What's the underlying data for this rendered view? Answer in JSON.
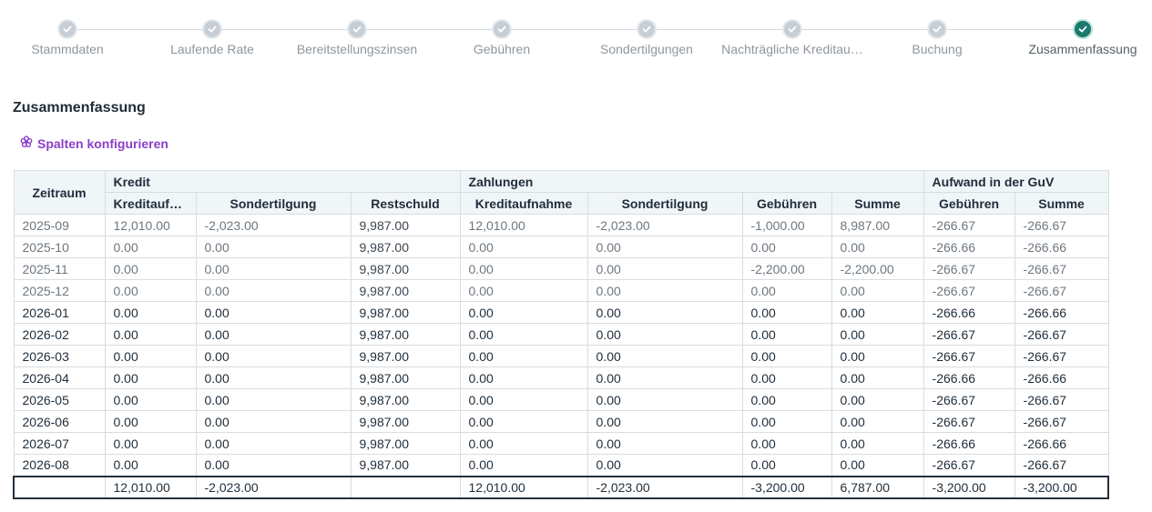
{
  "stepper": {
    "steps": [
      {
        "label": "Stammdaten",
        "state": "done"
      },
      {
        "label": "Laufende Rate",
        "state": "done"
      },
      {
        "label": "Bereitstellungszinsen",
        "state": "done"
      },
      {
        "label": "Gebühren",
        "state": "done"
      },
      {
        "label": "Sondertilgungen",
        "state": "done"
      },
      {
        "label": "Nachträgliche Kreditau…",
        "state": "done"
      },
      {
        "label": "Buchung",
        "state": "done"
      },
      {
        "label": "Zusammenfassung",
        "state": "active"
      }
    ],
    "colors": {
      "done": "#c7ced5",
      "active": "#1b7a6e"
    }
  },
  "page": {
    "title": "Zusammenfassung",
    "configure_label": "Spalten konfigurieren",
    "configure_icon": "flower-settings-icon",
    "accent_color": "#8b3fc9"
  },
  "table": {
    "col_zeitraum": "Zeitraum",
    "groups": {
      "kredit": "Kredit",
      "zahlungen": "Zahlungen",
      "aufwand": "Aufwand in der GuV"
    },
    "sub_headers": [
      "Kreditaufnahme",
      "Sondertilgung",
      "Restschuld",
      "Kreditaufnahme",
      "Sondertilgung",
      "Gebühren",
      "Summe",
      "Gebühren",
      "Summe"
    ],
    "rows": [
      {
        "past": true,
        "cells": [
          "2025-09",
          "12,010.00",
          "-2,023.00",
          "9,987.00",
          "12,010.00",
          "-2,023.00",
          "-1,000.00",
          "8,987.00",
          "-266.67",
          "-266.67"
        ]
      },
      {
        "past": true,
        "cells": [
          "2025-10",
          "0.00",
          "0.00",
          "9,987.00",
          "0.00",
          "0.00",
          "0.00",
          "0.00",
          "-266.66",
          "-266.66"
        ]
      },
      {
        "past": true,
        "cells": [
          "2025-11",
          "0.00",
          "0.00",
          "9,987.00",
          "0.00",
          "0.00",
          "-2,200.00",
          "-2,200.00",
          "-266.67",
          "-266.67"
        ]
      },
      {
        "past": true,
        "cells": [
          "2025-12",
          "0.00",
          "0.00",
          "9,987.00",
          "0.00",
          "0.00",
          "0.00",
          "0.00",
          "-266.67",
          "-266.67"
        ]
      },
      {
        "past": false,
        "cells": [
          "2026-01",
          "0.00",
          "0.00",
          "9,987.00",
          "0.00",
          "0.00",
          "0.00",
          "0.00",
          "-266.66",
          "-266.66"
        ]
      },
      {
        "past": false,
        "cells": [
          "2026-02",
          "0.00",
          "0.00",
          "9,987.00",
          "0.00",
          "0.00",
          "0.00",
          "0.00",
          "-266.67",
          "-266.67"
        ]
      },
      {
        "past": false,
        "cells": [
          "2026-03",
          "0.00",
          "0.00",
          "9,987.00",
          "0.00",
          "0.00",
          "0.00",
          "0.00",
          "-266.67",
          "-266.67"
        ]
      },
      {
        "past": false,
        "cells": [
          "2026-04",
          "0.00",
          "0.00",
          "9,987.00",
          "0.00",
          "0.00",
          "0.00",
          "0.00",
          "-266.66",
          "-266.66"
        ]
      },
      {
        "past": false,
        "cells": [
          "2026-05",
          "0.00",
          "0.00",
          "9,987.00",
          "0.00",
          "0.00",
          "0.00",
          "0.00",
          "-266.67",
          "-266.67"
        ]
      },
      {
        "past": false,
        "cells": [
          "2026-06",
          "0.00",
          "0.00",
          "9,987.00",
          "0.00",
          "0.00",
          "0.00",
          "0.00",
          "-266.67",
          "-266.67"
        ]
      },
      {
        "past": false,
        "cells": [
          "2026-07",
          "0.00",
          "0.00",
          "9,987.00",
          "0.00",
          "0.00",
          "0.00",
          "0.00",
          "-266.66",
          "-266.66"
        ]
      },
      {
        "past": false,
        "cells": [
          "2026-08",
          "0.00",
          "0.00",
          "9,987.00",
          "0.00",
          "0.00",
          "0.00",
          "0.00",
          "-266.67",
          "-266.67"
        ]
      }
    ],
    "totals": [
      "",
      "12,010.00",
      "-2,023.00",
      "",
      "12,010.00",
      "-2,023.00",
      "-3,200.00",
      "6,787.00",
      "-3,200.00",
      "-3,200.00"
    ]
  }
}
